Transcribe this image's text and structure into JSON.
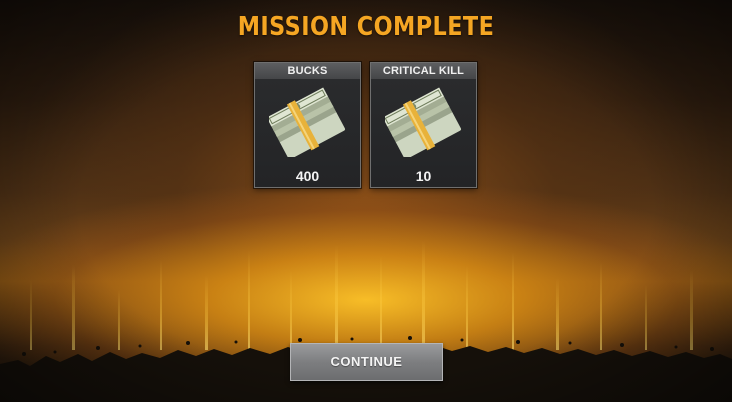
{
  "screen": {
    "title": "MISSION COMPLETE"
  },
  "rewards": [
    {
      "label": "BUCKS",
      "value": "400",
      "icon": "cash-stack-icon"
    },
    {
      "label": "CRITICAL KILL",
      "value": "10",
      "icon": "cash-stack-icon"
    }
  ],
  "actions": {
    "continue_label": "CONTINUE"
  },
  "colors": {
    "title": "#f5a623",
    "glow": "#ffc428",
    "button": "#8a8b8d",
    "card": "#2b2c2e"
  }
}
